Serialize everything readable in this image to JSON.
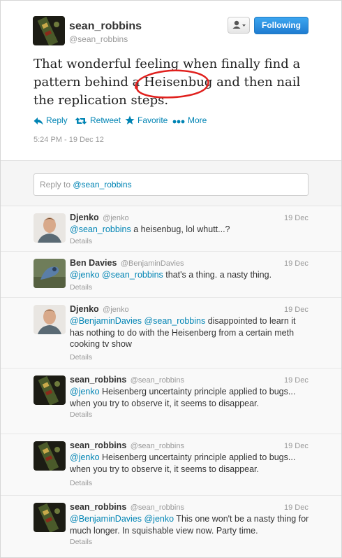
{
  "main_tweet": {
    "display_name": "sean_robbins",
    "handle": "@sean_robbins",
    "follow_label": "Following",
    "text_line_1": "That wonderful feeling when finally find a",
    "text_line_2a": "pattern behind a ",
    "text_highlight": "Heisenbug",
    "text_line_2b": " and then nail",
    "text_line_3": "the replication steps.",
    "actions": {
      "reply": "Reply",
      "retweet": "Retweet",
      "favorite": "Favorite",
      "more": "More"
    },
    "timestamp": "5:24 PM - 19 Dec 12",
    "annotation_color": "#e0201d"
  },
  "reply_box": {
    "prefix": "Reply to ",
    "mention": "@sean_robbins"
  },
  "replies": [
    {
      "name": "Djenko",
      "handle": "@jenko",
      "date": "19 Dec",
      "mentions": "@sean_robbins",
      "body": " a heisenbug, lol whutt...?",
      "details": "Details"
    },
    {
      "name": "Ben Davies",
      "handle": "@BenjaminDavies",
      "date": "19 Dec",
      "mentions": "@jenko @sean_robbins",
      "body": " that's a thing. a nasty thing.",
      "details": "Details"
    },
    {
      "name": "Djenko",
      "handle": "@jenko",
      "date": "19 Dec",
      "mentions": "@BenjaminDavies @sean_robbins",
      "body": " disappointed to learn it has nothing to do with the Heisenberg from a certain meth cooking tv show",
      "details": "Details"
    },
    {
      "name": "sean_robbins",
      "handle": "@sean_robbins",
      "date": "19 Dec",
      "mentions": "@jenko",
      "body": " Heisenberg uncertainty principle applied to bugs... when you try to observe it, it seems to disappear.",
      "details": "Details"
    },
    {
      "name": "sean_robbins",
      "handle": "@sean_robbins",
      "date": "19 Dec",
      "mentions": "@jenko",
      "body": " Heisenberg uncertainty principle applied to bugs... when you try to observe it, it seems to disappear.",
      "details": "Details"
    },
    {
      "name": "sean_robbins",
      "handle": "@sean_robbins",
      "date": "19 Dec",
      "mentions": "@BenjaminDavies @jenko",
      "body": " This one won't be a nasty thing for much longer. In squishable view now. Party time.",
      "details": "Details"
    }
  ],
  "colors": {
    "link": "#0084b4",
    "follow_button": "#1f7cd1",
    "muted_text": "#999999"
  }
}
